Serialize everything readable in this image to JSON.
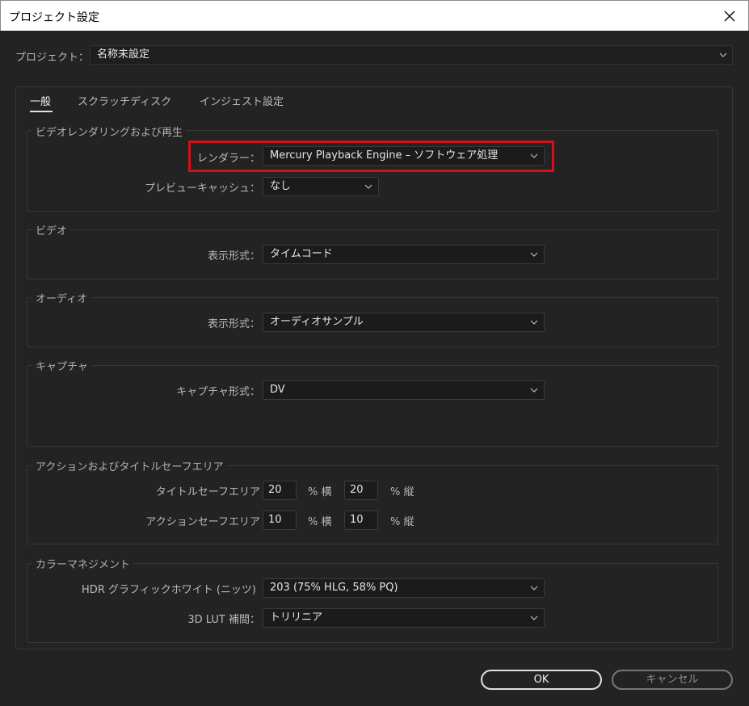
{
  "window": {
    "title": "プロジェクト設定"
  },
  "project": {
    "label": "プロジェクト：",
    "value": "名称未設定"
  },
  "tabs": [
    {
      "label": "一般",
      "active": true
    },
    {
      "label": "スクラッチディスク",
      "active": false
    },
    {
      "label": "インジェスト設定",
      "active": false
    }
  ],
  "render": {
    "section_title": "ビデオレンダリングおよび再生",
    "renderer_label": "レンダラー：",
    "renderer_value": "Mercury Playback Engine – ソフトウェア処理",
    "preview_label": "プレビューキャッシュ：",
    "preview_value": "なし"
  },
  "video": {
    "section_title": "ビデオ",
    "format_label": "表示形式：",
    "format_value": "タイムコード"
  },
  "audio": {
    "section_title": "オーディオ",
    "format_label": "表示形式：",
    "format_value": "オーディオサンプル"
  },
  "capture": {
    "section_title": "キャプチャ",
    "format_label": "キャプチャ形式：",
    "format_value": "DV"
  },
  "safe": {
    "section_title": "アクションおよびタイトルセーフエリア",
    "title_label": "タイトルセーフエリア",
    "title_h": "20",
    "title_v": "20",
    "action_label": "アクションセーフエリア",
    "action_h": "10",
    "action_v": "10",
    "h_unit": "% 横",
    "v_unit": "% 縦"
  },
  "color": {
    "section_title": "カラーマネジメント",
    "hdr_label": "HDR グラフィックホワイト (ニッツ)",
    "hdr_value": "203 (75% HLG, 58% PQ)",
    "lut_label": "3D LUT 補間：",
    "lut_value": "トリリニア"
  },
  "buttons": {
    "ok": "OK",
    "cancel": "キャンセル"
  },
  "colors": {
    "highlight": "#d4101a",
    "background": "#232323"
  },
  "icons": {
    "close": "close-icon",
    "dropdown": "chevron-down-icon"
  }
}
